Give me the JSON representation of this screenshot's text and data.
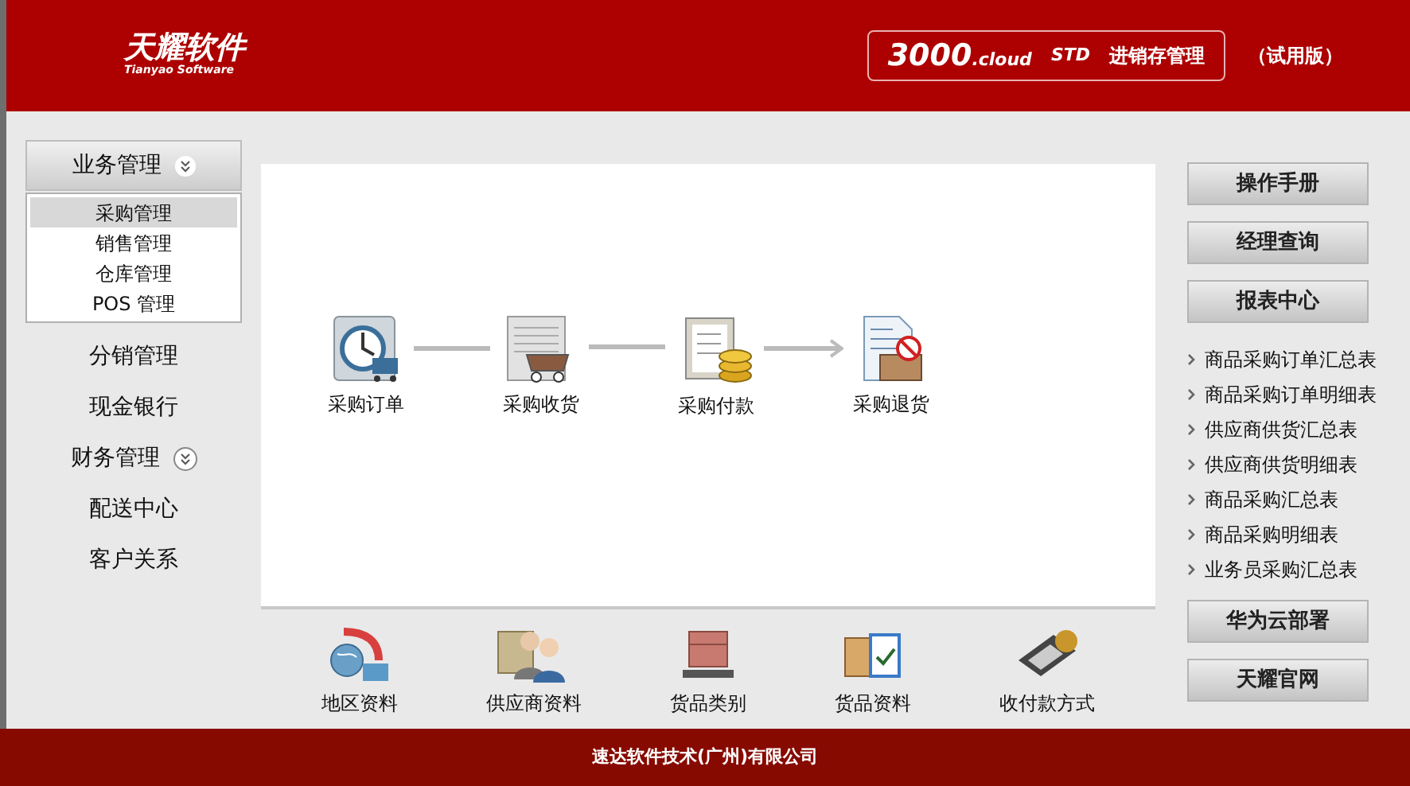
{
  "header": {
    "logo": "天耀软件",
    "logo_sub": "Tianyao Software",
    "product": {
      "number": "3000",
      "suffix": ".cloud",
      "edition": "STD",
      "name": "进销存管理"
    },
    "trial": "（试用版）"
  },
  "nav": [
    {
      "label": "业务管理",
      "expanded": true,
      "children": [
        {
          "label": "采购管理",
          "selected": true
        },
        {
          "label": "销售管理",
          "selected": false
        },
        {
          "label": "仓库管理",
          "selected": false
        },
        {
          "label": "POS 管理",
          "selected": false
        }
      ]
    },
    {
      "label": "分销管理"
    },
    {
      "label": "现金银行"
    },
    {
      "label": "财务管理",
      "expanded": false
    },
    {
      "label": "配送中心"
    },
    {
      "label": "客户关系"
    }
  ],
  "flow": [
    {
      "label": "采购订单",
      "kind": "order"
    },
    {
      "label": "采购收货",
      "kind": "receive"
    },
    {
      "label": "采购付款",
      "kind": "pay"
    },
    {
      "label": "采购退货",
      "kind": "return"
    }
  ],
  "shortcuts": [
    {
      "label": "地区资料",
      "kind": "region"
    },
    {
      "label": "供应商资料",
      "kind": "supplier"
    },
    {
      "label": "货品类别",
      "kind": "category"
    },
    {
      "label": "货品资料",
      "kind": "goods"
    },
    {
      "label": "收付款方式",
      "kind": "payment"
    }
  ],
  "right_buttons": [
    "操作手册",
    "经理查询",
    "报表中心"
  ],
  "reports": [
    "商品采购订单汇总表",
    "商品采购订单明细表",
    "供应商供货汇总表",
    "供应商供货明细表",
    "商品采购汇总表",
    "商品采购明细表",
    "业务员采购汇总表"
  ],
  "bottom_buttons": [
    "华为云部署",
    "天耀官网"
  ],
  "footer": "速达软件技术(广州)有限公司"
}
